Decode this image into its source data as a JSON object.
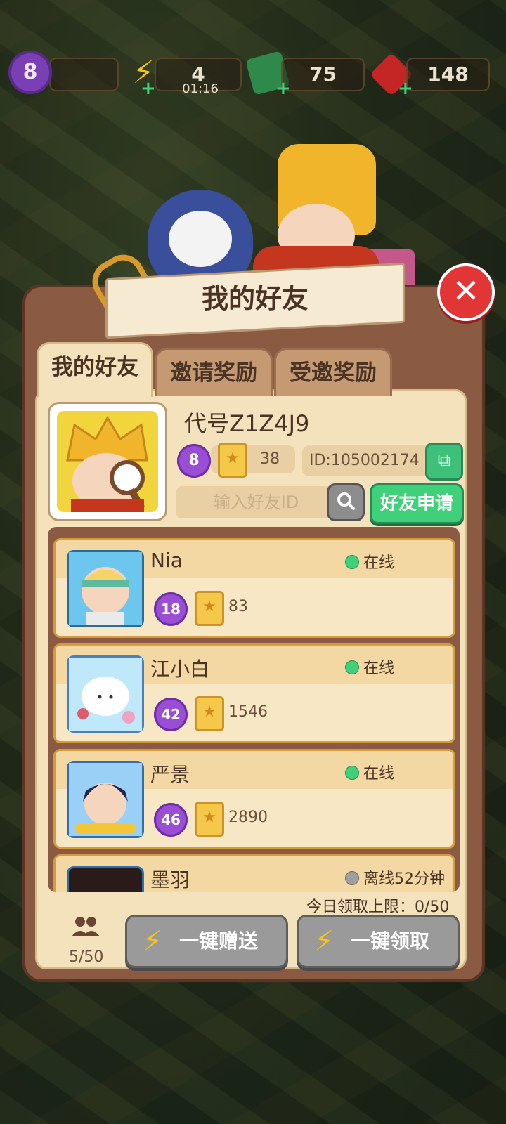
{
  "topbar": {
    "level": "8",
    "energy": "4",
    "energy_timer": "01:16",
    "cash": "75",
    "gems": "148"
  },
  "panel": {
    "title": "我的好友",
    "tabs": [
      {
        "label": "我的好友",
        "active": true
      },
      {
        "label": "邀请奖励",
        "active": false
      },
      {
        "label": "受邀奖励",
        "active": false
      }
    ]
  },
  "profile": {
    "name": "代号Z1Z4J9",
    "level": "8",
    "stars": "38",
    "id_text": "ID:105002174"
  },
  "search": {
    "placeholder": "输入好友ID",
    "apply_label": "好友申请"
  },
  "friends": [
    {
      "name": "Nia",
      "status": "在线",
      "online": true,
      "level": "18",
      "score": "83"
    },
    {
      "name": "江小白",
      "status": "在线",
      "online": true,
      "level": "42",
      "score": "1546"
    },
    {
      "name": "严景",
      "status": "在线",
      "online": true,
      "level": "46",
      "score": "2890"
    },
    {
      "name": "墨羽",
      "status": "离线52分钟",
      "online": false,
      "level": "",
      "score": ""
    }
  ],
  "footer": {
    "daily_limit": "今日领取上限：0/50",
    "friend_count": "5/50",
    "send_all": "一键赠送",
    "claim_all": "一键领取"
  },
  "colors": {
    "online": "#3fd07a",
    "offline": "#a0a0a0",
    "panel": "#8a5a42",
    "accent_green": "#3fd07a",
    "close_red": "#e23636"
  }
}
